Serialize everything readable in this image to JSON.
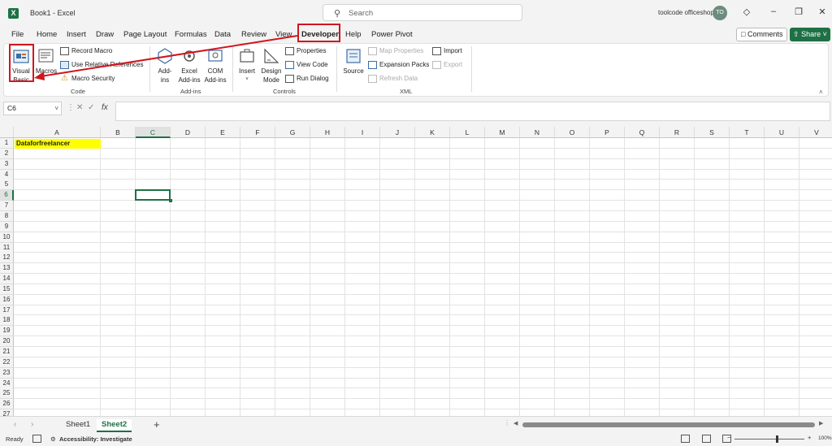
{
  "titlebar": {
    "app_title": "Book1  -  Excel",
    "search_placeholder": "Search",
    "account_name": "toolcode officeshop",
    "avatar_initials": "TO"
  },
  "menu": {
    "tabs": [
      "File",
      "Home",
      "Insert",
      "Draw",
      "Page Layout",
      "Formulas",
      "Data",
      "Review",
      "View",
      "Developer",
      "Help",
      "Power Pivot"
    ],
    "active_tab": "Developer",
    "comments_label": "Comments",
    "share_label": "Share"
  },
  "ribbon": {
    "code": {
      "label": "Code",
      "visual_basic": "Visual Basic",
      "macros": "Macros",
      "record_macro": "Record Macro",
      "use_relative": "Use Relative References",
      "macro_security": "Macro Security"
    },
    "addins": {
      "label": "Add-ins",
      "addins": "Add-ins",
      "excel_addins": "Excel Add-ins",
      "com_addins": "COM Add-ins"
    },
    "controls": {
      "label": "Controls",
      "insert": "Insert",
      "design_mode": "Design Mode",
      "properties": "Properties",
      "view_code": "View Code",
      "run_dialog": "Run Dialog"
    },
    "xml": {
      "label": "XML",
      "source": "Source",
      "map_properties": "Map Properties",
      "expansion_packs": "Expansion Packs",
      "refresh_data": "Refresh Data",
      "import": "Import",
      "export": "Export"
    }
  },
  "formula_bar": {
    "name_box": "C6",
    "formula": ""
  },
  "grid": {
    "columns": [
      "A",
      "B",
      "C",
      "D",
      "E",
      "F",
      "G",
      "H",
      "I",
      "J",
      "K",
      "L",
      "M",
      "N",
      "O",
      "P",
      "Q",
      "R",
      "S",
      "T",
      "U",
      "V"
    ],
    "rows": [
      "1",
      "2",
      "3",
      "4",
      "5",
      "6",
      "7",
      "8",
      "9",
      "10",
      "11",
      "12",
      "13",
      "14",
      "15",
      "16",
      "17",
      "18",
      "19",
      "20",
      "21",
      "22",
      "23",
      "24",
      "25",
      "26",
      "27"
    ],
    "selected_column": "C",
    "selected_row": "6",
    "cells": {
      "A1": "Dataforfreelancer"
    }
  },
  "sheets": {
    "tabs": [
      "Sheet1",
      "Sheet2"
    ],
    "active": "Sheet2"
  },
  "status": {
    "ready": "Ready",
    "accessibility": "Accessibility: Investigate",
    "zoom": "100%"
  },
  "colors": {
    "excel_green": "#1e7145",
    "highlight_red": "#d0161d",
    "cell_yellow": "#ffff00"
  }
}
